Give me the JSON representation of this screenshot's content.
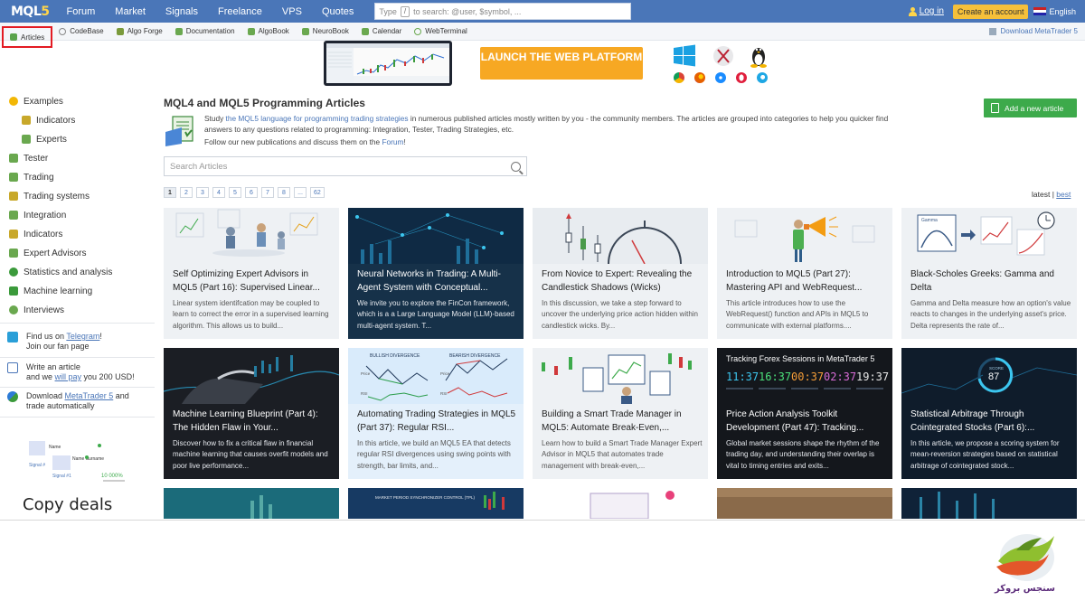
{
  "topbar": {
    "logo": "MQL5",
    "nav": [
      "Forum",
      "Market",
      "Signals",
      "Freelance",
      "VPS",
      "Quotes"
    ],
    "search_placeholder_pre": "Type",
    "search_key": "/",
    "search_placeholder_post": "to search: @user, $symbol, ...",
    "login": "Log in",
    "create_account": "Create an account",
    "language": "English"
  },
  "subnav": {
    "items": [
      "Articles",
      "CodeBase",
      "Algo Forge",
      "Documentation",
      "AlgoBook",
      "NeuroBook",
      "Calendar",
      "WebTerminal"
    ],
    "download": "Download MetaTrader 5"
  },
  "banner": {
    "launch": "LAUNCH THE WEB PLATFORM"
  },
  "sidebar": {
    "items": [
      "Examples",
      "Indicators",
      "Experts",
      "Tester",
      "Trading",
      "Trading systems",
      "Integration",
      "Indicators",
      "Expert Advisors",
      "Statistics and analysis",
      "Machine learning",
      "Interviews"
    ],
    "promo_telegram_pre": "Find us on ",
    "promo_telegram_link": "Telegram",
    "promo_telegram_post": "!",
    "promo_telegram_line2": "Join our fan page",
    "promo_write_line1": "Write an article",
    "promo_write_pre": "and we ",
    "promo_write_link": "will pay",
    "promo_write_post": " you 200 USD!",
    "promo_download_pre": "Download ",
    "promo_download_link": "MetaTrader 5",
    "promo_download_post": " and",
    "promo_download_line2": "trade automatically",
    "signal_name1": "Name",
    "signal_name2": "Name Surname",
    "signal_label1": "Signal #",
    "signal_label2": "Signal #1",
    "signal_growth": "10 000%",
    "copy_deals": "Copy deals"
  },
  "main": {
    "title": "MQL4 and MQL5 Programming Articles",
    "intro_pre": "Study ",
    "intro_link1": "the MQL5 language for programming trading strategies",
    "intro_mid": " in numerous published articles mostly written by you - the community members. The articles are grouped into categories to help you quicker find answers to any questions related to programming: Integration, Tester, Trading Strategies, etc.",
    "intro_line2_pre": "Follow our new publications and discuss them on the ",
    "intro_link2": "Forum",
    "intro_line2_post": "!",
    "add_article": "Add a new article",
    "search_placeholder": "Search Articles",
    "pages": [
      "1",
      "2",
      "3",
      "4",
      "5",
      "6",
      "7",
      "8",
      "...",
      "62"
    ],
    "sort_latest": "latest",
    "sort_sep": " | ",
    "sort_best": "best"
  },
  "articles": [
    {
      "title": "Self Optimizing Expert Advisors in MQL5 (Part 16): Supervised Linear...",
      "desc": "Linear system identifcation may be coupled to learn to correct the error in a supervised learning algorithm. This allows us to build..."
    },
    {
      "title": "Neural Networks in Trading: A Multi-Agent System with Conceptual...",
      "desc": "We invite you to explore the FinCon framework, which is a a Large Language Model (LLM)-based multi-agent system. T..."
    },
    {
      "title": "From Novice to Expert: Revealing the Candlestick Shadows (Wicks)",
      "desc": "In this discussion, we take a step forward to uncover the underlying price action hidden within candlestick wicks. By..."
    },
    {
      "title": "Introduction to MQL5 (Part 27): Mastering API and WebRequest...",
      "desc": "This article introduces how to use the WebRequest() function and APIs in MQL5 to communicate with external platforms...."
    },
    {
      "title": "Black-Scholes Greeks: Gamma and Delta",
      "desc": "Gamma and Delta measure how an option's value reacts to changes in the underlying asset's price. Delta represents the rate of..."
    },
    {
      "title": "Machine Learning Blueprint (Part 4): The Hidden Flaw in Your...",
      "desc": "Discover how to fix a critical flaw in financial machine learning that causes overfit models and poor live performance..."
    },
    {
      "title": "Automating Trading Strategies in MQL5 (Part 37): Regular RSI...",
      "desc": "In this article, we build an MQL5 EA that detects regular RSI divergences using swing points with strength, bar limits, and..."
    },
    {
      "title": "Building a Smart Trade Manager in MQL5: Automate Break-Even,...",
      "desc": "Learn how to build a Smart Trade Manager Expert Advisor in MQL5 that automates trade management with break-even,..."
    },
    {
      "title": "Price Action Analysis Toolkit Development (Part 47): Tracking...",
      "desc": "Global market sessions shape the rhythm of the trading day, and understanding their overlap is vital to timing entries and exits..."
    },
    {
      "title": "Statistical Arbitrage Through Cointegrated Stocks (Part 6):...",
      "desc": "In this article, we propose a scoring system for mean-reversion strategies based on statistical arbitrage of cointegrated stock..."
    }
  ],
  "art_text": {
    "bullish": "BULLISH DIVERGENCE",
    "bearish": "BEARISH DIVERGENCE",
    "price": "Price",
    "rsi": "RSI",
    "gamma": "Gamma",
    "tracking": "Tracking Forex Sessions in MetaTrader 5",
    "clocks": [
      "11:37",
      "16:37",
      "00:37",
      "02:37",
      "19:37"
    ],
    "score": "SCORE",
    "score_value": "87",
    "market_period": "MARKET PERIOD SYNCHRONIZER CONTROL (TPL)"
  },
  "brand": {
    "text": "سنجس بروکر"
  },
  "colors": {
    "topbar": "#4a76b8",
    "accent_yellow": "#f6c03a",
    "launch_orange": "#f7a823",
    "add_green": "#3daa4b",
    "highlight_red": "#e31b23"
  }
}
